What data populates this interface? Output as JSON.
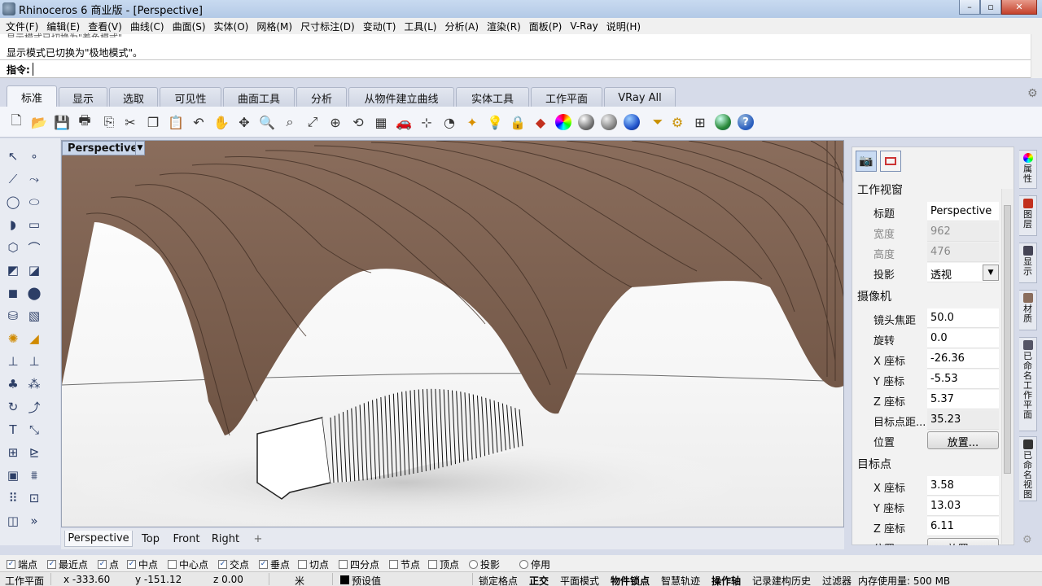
{
  "window": {
    "title": "Rhinoceros 6 商业版 - [Perspective]",
    "min": "–",
    "max": "▫",
    "close": "✕"
  },
  "menu": [
    "文件(F)",
    "编辑(E)",
    "查看(V)",
    "曲线(C)",
    "曲面(S)",
    "实体(O)",
    "网格(M)",
    "尺寸标注(D)",
    "变动(T)",
    "工具(L)",
    "分析(A)",
    "渲染(R)",
    "面板(P)",
    "V-Ray",
    "说明(H)"
  ],
  "command": {
    "history_partial": "显示模式已切换为\"着色模式\"。",
    "history_last": "显示模式已切换为\"极地模式\"。",
    "prompt": "指令:",
    "value": ""
  },
  "tabs": [
    "标准",
    "显示",
    "选取",
    "可见性",
    "曲面工具",
    "分析",
    "从物件建立曲线",
    "实体工具",
    "工作平面",
    "VRay All"
  ],
  "active_tab": "标准",
  "toolbar_icons": [
    "new-file-icon",
    "open-folder-icon",
    "save-icon",
    "print-icon",
    "import-icon",
    "cut-icon",
    "copy-icon",
    "paste-icon",
    "undo-icon",
    "pan-hand-icon",
    "rotate-view-icon",
    "zoom-dynamic-icon",
    "zoom-window-icon",
    "zoom-extents-icon",
    "zoom-selected-icon",
    "undo-view-icon",
    "four-viewports-icon",
    "named-views-car-icon",
    "set-view-icon",
    "cplane-icon",
    "lights-icon",
    "bulb-icon",
    "lock-icon",
    "layer-icon",
    "color-wheel-icon",
    "shaded-sphere-icon",
    "rendered-sphere-icon",
    "render-sphere-icon",
    "filter-icon",
    "settings-gears-icon",
    "grid-snap-icon",
    "globe-icon",
    "help-icon"
  ],
  "viewport": {
    "label": "Perspective",
    "tabs": [
      "Perspective",
      "Top",
      "Front",
      "Right"
    ],
    "add_tab": "+"
  },
  "properties": {
    "section_viewport": "工作视窗",
    "title_label": "标题",
    "title_value": "Perspective",
    "width_label": "宽度",
    "width_value": "962",
    "height_label": "高度",
    "height_value": "476",
    "projection_label": "投影",
    "projection_value": "透视",
    "section_camera": "摄像机",
    "focal_label": "镜头焦距",
    "focal_value": "50.0",
    "rotation_label": "旋转",
    "rotation_value": "0.0",
    "cx_label": "X 座标",
    "cx_value": "-26.36",
    "cy_label": "Y 座标",
    "cy_value": "-5.53",
    "cz_label": "Z 座标",
    "cz_value": "5.37",
    "target_dist_label": "目标点距...",
    "target_dist_value": "35.23",
    "location_label": "位置",
    "place_button": "放置...",
    "section_target": "目标点",
    "tx_label": "X 座标",
    "tx_value": "3.58",
    "ty_label": "Y 座标",
    "ty_value": "13.03",
    "tz_label": "Z 座标",
    "tz_value": "6.11",
    "location2_label": "位置",
    "place_button2": "放置..."
  },
  "side_tabs": [
    "属性",
    "图层",
    "显示",
    "材质",
    "已命名工作平面",
    "已命名视图"
  ],
  "osnaps": [
    {
      "label": "端点",
      "checked": true,
      "type": "check"
    },
    {
      "label": "最近点",
      "checked": true,
      "type": "check"
    },
    {
      "label": "点",
      "checked": true,
      "type": "check"
    },
    {
      "label": "中点",
      "checked": true,
      "type": "check"
    },
    {
      "label": "中心点",
      "checked": false,
      "type": "check"
    },
    {
      "label": "交点",
      "checked": true,
      "type": "check"
    },
    {
      "label": "垂点",
      "checked": true,
      "type": "check"
    },
    {
      "label": "切点",
      "checked": false,
      "type": "check"
    },
    {
      "label": "四分点",
      "checked": false,
      "type": "check"
    },
    {
      "label": "节点",
      "checked": false,
      "type": "check"
    },
    {
      "label": "顶点",
      "checked": false,
      "type": "check"
    },
    {
      "label": "投影",
      "checked": false,
      "type": "radio"
    },
    {
      "label": "停用",
      "checked": false,
      "type": "radio"
    }
  ],
  "status": {
    "cplane": "工作平面",
    "x": "x -333.60",
    "y": "y -151.12",
    "z": "z 0.00",
    "units": "米",
    "layer": "预设值",
    "grid_snap": "锁定格点",
    "ortho": "正交",
    "planar": "平面模式",
    "osnap": "物件锁点",
    "smarttrack": "智慧轨迹",
    "gumball": "操作轴",
    "history": "记录建构历史",
    "filter": "过滤器",
    "memory": "内存使用量: 500 MB"
  },
  "colors": {
    "accent": "#1a4fa0",
    "model_brown": "#7e6352",
    "titlebar": "#b3c9e6"
  }
}
